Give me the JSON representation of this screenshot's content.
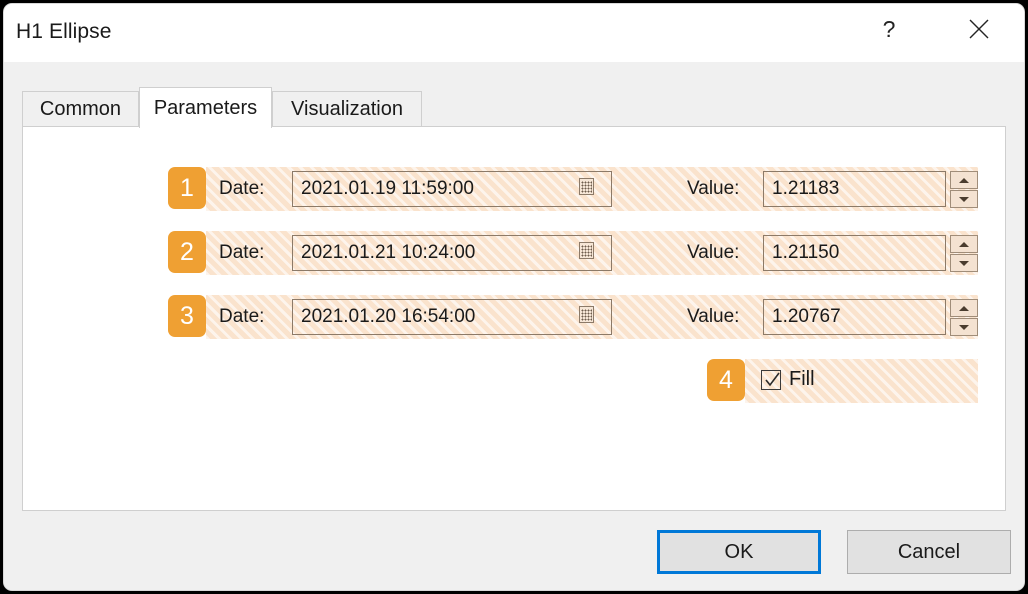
{
  "window": {
    "title": "H1 Ellipse",
    "help_label": "?",
    "close_label": "close-icon"
  },
  "tabs": [
    {
      "label": "Common",
      "active": false
    },
    {
      "label": "Parameters",
      "active": true
    },
    {
      "label": "Visualization",
      "active": false
    }
  ],
  "parameters": {
    "date_label": "Date:",
    "value_label": "Value:",
    "rows": [
      {
        "badge": "1",
        "date": "2021.01.19 11:59:00",
        "value": "1.21183"
      },
      {
        "badge": "2",
        "date": "2021.01.21 10:24:00",
        "value": "1.21150"
      },
      {
        "badge": "3",
        "date": "2021.01.20 16:54:00",
        "value": "1.20767"
      }
    ],
    "fill": {
      "badge": "4",
      "label": "Fill",
      "checked": true
    }
  },
  "footer": {
    "ok_label": "OK",
    "cancel_label": "Cancel"
  },
  "colors": {
    "badge_orange": "#efa033",
    "hatch_base": "#fae3cd",
    "focus_blue": "#0078d7",
    "dialog_bg": "#f0f0f0"
  }
}
